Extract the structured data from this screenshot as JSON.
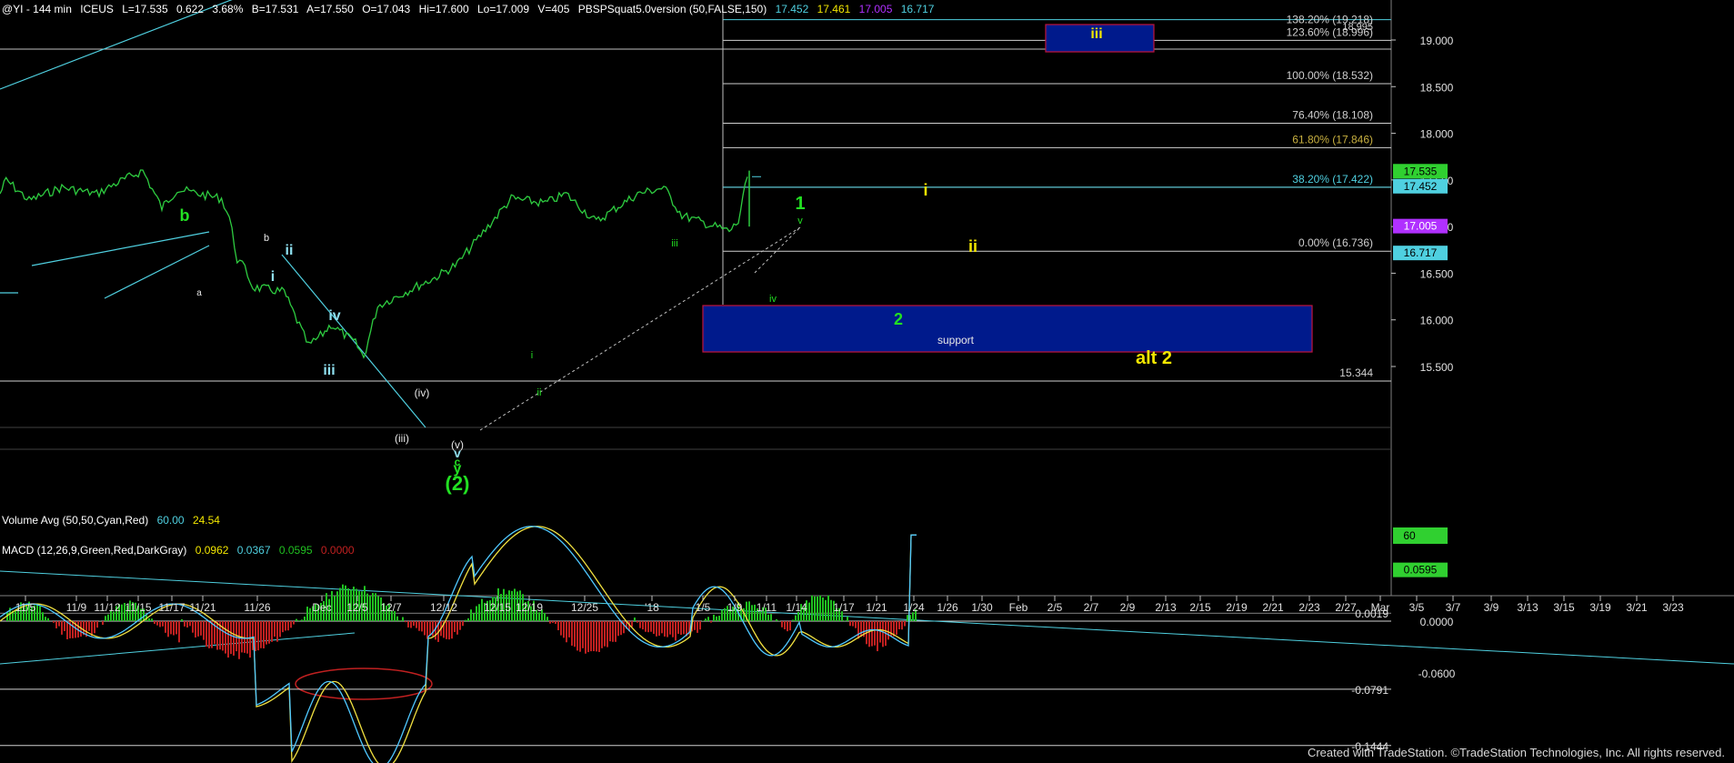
{
  "header": {
    "symbol": "@YI - 144 min",
    "exchange": "ICEUS",
    "last": "L=17.535",
    "change": "0.622",
    "change_pct": "3.68%",
    "bid": "B=17.531",
    "ask": "A=17.550",
    "open": "O=17.043",
    "high": "Hi=17.600",
    "low": "Lo=17.009",
    "volume": "V=405",
    "study": "PBSPSquat5.0version (50,FALSE,150)",
    "study_v1": "17.452",
    "study_v2": "17.461",
    "study_v3": "17.005",
    "study_v4": "16.717"
  },
  "volume_header": {
    "label": "Volume Avg (50,50,Cyan,Red)",
    "v1": "60.00",
    "v2": "24.54"
  },
  "macd_header": {
    "label": "MACD (12,26,9,Green,Red,DarkGray)",
    "v1": "0.0962",
    "v2": "0.0367",
    "v3": "0.0595",
    "v4": "0.0000"
  },
  "footer": "Created with TradeStation. ©TradeStation Technologies, Inc. All rights reserved.",
  "colors": {
    "background": "#000000",
    "price_bars": "#2ecc40",
    "cyan": "#4fd0e0",
    "yellow_label": "#f2e600",
    "green_label": "#22e022",
    "box_fill": "#001a8c",
    "box_border": "#c0143c",
    "macd_line": "#f0e040",
    "signal_line": "#4fc8ff",
    "hist_pos": "#20c020",
    "hist_neg": "#c02020"
  },
  "chart_data": {
    "type": "line",
    "ylim": [
      15.0,
      19.2
    ],
    "y_ticks": [
      "19.000",
      "18.500",
      "18.000",
      "17.500",
      "17.000",
      "16.500",
      "16.000",
      "15.500"
    ],
    "x_ticks": [
      "11/5",
      "11/9",
      "11/12",
      "11/15",
      "11/17",
      "11/21",
      "11/26",
      "Dec",
      "12/5",
      "12/7",
      "12/12",
      "12/15",
      "12/19",
      "12/25",
      "'18",
      "1/5",
      "1/9",
      "1/11",
      "1/14",
      "1/17",
      "1/21",
      "1/24",
      "1/26",
      "1/30",
      "Feb",
      "2/5",
      "2/7",
      "2/9",
      "2/13",
      "2/15",
      "2/19",
      "2/21",
      "2/23",
      "2/27",
      "Mar",
      "3/5",
      "3/7",
      "3/9",
      "3/13",
      "3/15",
      "3/19",
      "3/21",
      "3/23"
    ],
    "price_path": [
      {
        "x": "11/2",
        "y": 17.35
      },
      {
        "x": "11/3",
        "y": 17.5
      },
      {
        "x": "11/6",
        "y": 17.28
      },
      {
        "x": "11/9",
        "y": 17.42
      },
      {
        "x": "11/13",
        "y": 17.35
      },
      {
        "x": "11/15",
        "y": 17.45
      },
      {
        "x": "11/17",
        "y": 17.6
      },
      {
        "x": "11/20",
        "y": 17.2
      },
      {
        "x": "11/22",
        "y": 17.4
      },
      {
        "x": "11/27",
        "y": 17.3
      },
      {
        "x": "11/28",
        "y": 17.1
      },
      {
        "x": "11/29",
        "y": 16.65
      },
      {
        "x": "11/30",
        "y": 16.55
      },
      {
        "x": "12/1",
        "y": 16.35
      },
      {
        "x": "12/4",
        "y": 16.3
      },
      {
        "x": "12/5",
        "y": 16.05
      },
      {
        "x": "12/6",
        "y": 15.72
      },
      {
        "x": "12/7",
        "y": 15.85
      },
      {
        "x": "12/8",
        "y": 15.95
      },
      {
        "x": "12/11",
        "y": 15.75
      },
      {
        "x": "12/12",
        "y": 15.6
      },
      {
        "x": "12/13",
        "y": 16.15
      },
      {
        "x": "12/15",
        "y": 16.3
      },
      {
        "x": "12/19",
        "y": 16.45
      },
      {
        "x": "12/22",
        "y": 16.6
      },
      {
        "x": "12/26",
        "y": 17.0
      },
      {
        "x": "12/29",
        "y": 17.3
      },
      {
        "x": "1/2",
        "y": 17.25
      },
      {
        "x": "1/4",
        "y": 17.35
      },
      {
        "x": "1/8",
        "y": 17.05
      },
      {
        "x": "1/10",
        "y": 17.2
      },
      {
        "x": "1/12",
        "y": 17.35
      },
      {
        "x": "1/15",
        "y": 17.42
      },
      {
        "x": "1/17",
        "y": 17.12
      },
      {
        "x": "1/19",
        "y": 17.05
      },
      {
        "x": "1/22",
        "y": 16.95
      },
      {
        "x": "1/23",
        "y": 17.05
      },
      {
        "x": "1/24",
        "y": 17.535
      }
    ],
    "horizontal_levels": [
      {
        "label": "123.60% (18.996)",
        "y": 18.996
      },
      {
        "label": "100.00% (18.532)",
        "y": 18.532
      },
      {
        "label": "76.40% (18.108)",
        "y": 18.108
      },
      {
        "label": "61.80% (17.846)",
        "y": 17.846
      },
      {
        "label": "38.20% (17.422)",
        "y": 17.422
      },
      {
        "label": "0.00% (16.736)",
        "y": 16.736
      },
      {
        "label": "15.344",
        "y": 15.344
      }
    ],
    "top_partial_level": {
      "label": "138.20% (19.218)",
      "y": 19.218
    },
    "extra_right_value": "18.995",
    "right_price_labels": [
      "17.535",
      "17.452",
      "17.005",
      "16.717"
    ],
    "wave_labels": [
      {
        "text": "b",
        "color": "green"
      },
      {
        "text": "a",
        "color": "white"
      },
      {
        "text": "b",
        "color": "white"
      },
      {
        "text": "i",
        "color": "cyan"
      },
      {
        "text": "ii",
        "color": "cyan"
      },
      {
        "text": "iii",
        "color": "cyan"
      },
      {
        "text": "iv",
        "color": "cyan"
      },
      {
        "text": "(iii)",
        "color": "white"
      },
      {
        "text": "(iv)",
        "color": "white"
      },
      {
        "text": "(v)",
        "color": "white"
      },
      {
        "text": "v",
        "color": "cyan"
      },
      {
        "text": "c",
        "color": "green"
      },
      {
        "text": "y",
        "color": "green"
      },
      {
        "text": "(2)",
        "color": "green"
      },
      {
        "text": "i",
        "color": "green"
      },
      {
        "text": "ii",
        "color": "green"
      },
      {
        "text": "iii",
        "color": "green"
      },
      {
        "text": "iv",
        "color": "green"
      },
      {
        "text": "v",
        "color": "green"
      },
      {
        "text": "1",
        "color": "green"
      },
      {
        "text": "2",
        "color": "green"
      },
      {
        "text": "i",
        "color": "yellow"
      },
      {
        "text": "ii",
        "color": "yellow"
      },
      {
        "text": "iii",
        "color": "yellow"
      },
      {
        "text": "alt 2",
        "color": "yellow"
      },
      {
        "text": "support",
        "color": "white"
      }
    ],
    "macd": {
      "ylim": [
        -0.17,
        0.14
      ],
      "y_ticks": [
        "0.0019",
        "0.0000",
        "-0.0600",
        "-0.0791",
        "-0.1444"
      ],
      "current_label": "0.0595"
    },
    "volume": {
      "current_label": "60"
    }
  }
}
